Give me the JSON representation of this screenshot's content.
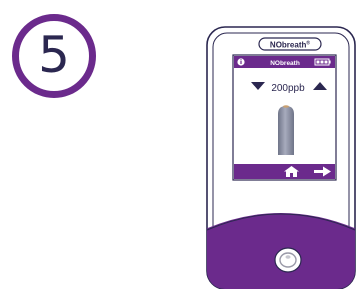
{
  "step": {
    "number": "5"
  },
  "device": {
    "brand_name": "NObreath",
    "brand_mark": "®",
    "colors": {
      "accent": "#6b2a8c",
      "outline": "#2b2750",
      "tube": "#8a8fa3"
    },
    "screen": {
      "header": {
        "info_icon": "info-icon",
        "brand": "NObreath",
        "battery_icon": "battery-icon"
      },
      "level": {
        "value": "200ppb",
        "down_icon": "triangle-down-icon",
        "up_icon": "triangle-up-icon"
      },
      "footer": {
        "home_icon": "home-icon",
        "next_icon": "arrow-right-icon"
      }
    }
  }
}
